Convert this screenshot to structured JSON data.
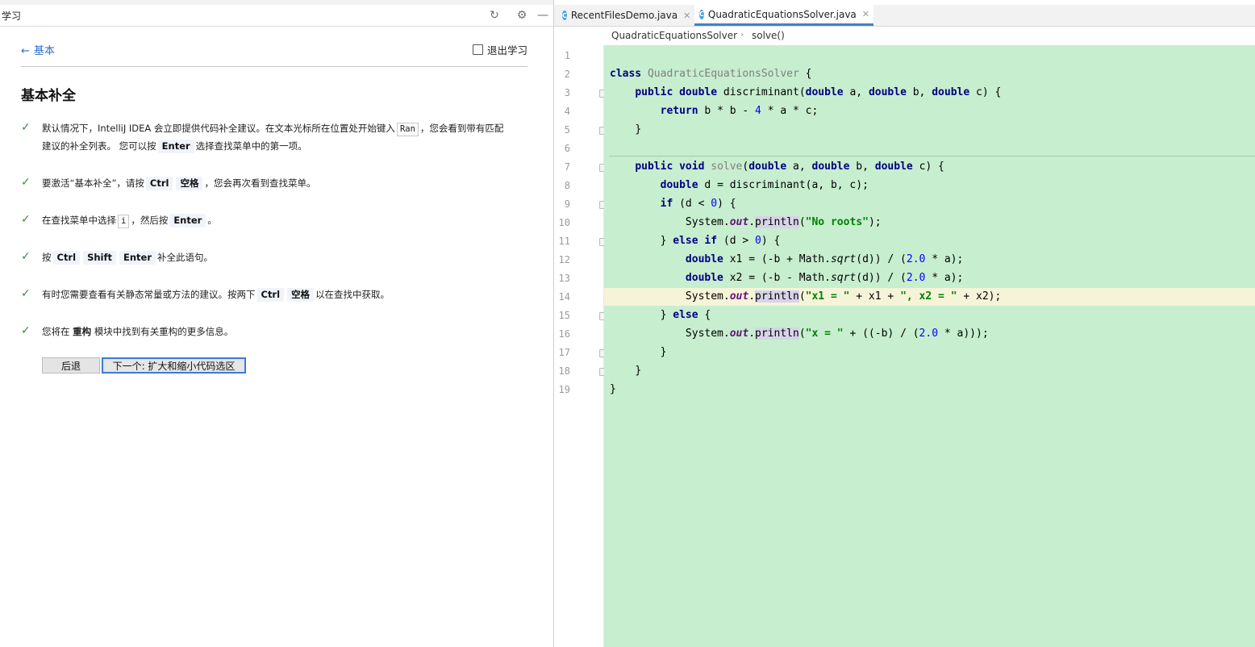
{
  "learn": {
    "panel_title": "学习",
    "back_label": "基本",
    "exit_label": "退出学习",
    "lesson_title": "基本补全",
    "steps": [
      {
        "t1": "默认情况下，IntelliJ IDEA 会立即提供代码补全建议。在文本光标所在位置处开始键入",
        "code": "Ran",
        "t2": "，您会看到带有匹配",
        "t3": "建议的补全列表。 您可以按",
        "key": "Enter",
        "t4": "选择查找菜单中的第一项。"
      },
      {
        "t1": "要激活“基本补全”，请按",
        "key1": "Ctrl",
        "key2": "空格",
        "t2": "，您会再次看到查找菜单。"
      },
      {
        "t1": "在查找菜单中选择",
        "code": "i",
        "t2": "，然后按",
        "key": "Enter",
        "t3": "。"
      },
      {
        "t1": "按",
        "key1": "Ctrl",
        "key2": "Shift",
        "key3": "Enter",
        "t2": "补全此语句。"
      },
      {
        "t1": "有时您需要查看有关静态常量或方法的建议。按两下",
        "key1": "Ctrl",
        "key2": "空格",
        "t2": "以在查找中获取。"
      },
      {
        "t1": "您将在",
        "bold": "重构",
        "t2": "模块中找到有关重构的更多信息。"
      }
    ],
    "btn_back": "后退",
    "btn_next": "下一个: 扩大和缩小代码选区"
  },
  "editor": {
    "tabs": [
      "RecentFilesDemo.java",
      "QuadraticEquationsSolver.java"
    ],
    "breadcrumb": [
      "QuadraticEquationsSolver",
      "solve()"
    ],
    "line_numbers": [
      "1",
      "2",
      "3",
      "4",
      "5",
      "6",
      "7",
      "8",
      "9",
      "10",
      "11",
      "12",
      "13",
      "14",
      "15",
      "16",
      "17",
      "18",
      "19"
    ],
    "code": {
      "l2_kw": "class",
      "l2_name": "QuadraticEquationsSolver",
      "l2_rest": " {",
      "l3": {
        "a": "public",
        "b": "double",
        "c": " discriminant(",
        "d": "double",
        "e": " a, ",
        "f": "double",
        "g": " b, ",
        "h": "double",
        "i": " c) {"
      },
      "l4": {
        "kw": "return",
        "a": " b * b - ",
        "num": "4",
        "b": " * a * c;"
      },
      "l5": "}",
      "l7": {
        "a": "public",
        "b": "void",
        "name": "solve",
        "c": "(",
        "d": "double",
        "e": " a, ",
        "f": "double",
        "g": " b, ",
        "h": "double",
        "i": " c) {"
      },
      "l8": {
        "kw": "double",
        "rest": " d = discriminant(a, b, c);"
      },
      "l9": {
        "kw": "if",
        "a": " (d < ",
        "num": "0",
        "b": ") {"
      },
      "l10": {
        "a": "System.",
        "fld": "out",
        "b": ".",
        "m": "println",
        "c": "(",
        "str": "\"No roots\"",
        "d": ");"
      },
      "l11": {
        "a": "} ",
        "kw1": "else",
        "sp": " ",
        "kw2": "if",
        "b": " (d > ",
        "num": "0",
        "c": ") {"
      },
      "l12": {
        "kw": "double",
        "a": " x1 = (-b + Math.",
        "m": "sqrt",
        "b": "(d)) / (",
        "num": "2.0",
        "c": " * a);"
      },
      "l13": {
        "kw": "double",
        "a": " x2 = (-b - Math.",
        "m": "sqrt",
        "b": "(d)) / (",
        "num": "2.0",
        "c": " * a);"
      },
      "l14": {
        "a": "System.",
        "fld": "out",
        "b": ".",
        "m": "println",
        "c": "(",
        "s1": "\"x1 = \"",
        "d": " + x1 + ",
        "s2": "\", x2 = \"",
        "e": " + x2);"
      },
      "l15": {
        "a": "} ",
        "kw": "else",
        "b": " {"
      },
      "l16": {
        "a": "System.",
        "fld": "out",
        "b": ".",
        "m": "println",
        "c": "(",
        "str": "\"x = \"",
        "d": " + ((-b) / (",
        "num": "2.0",
        "e": " * a)));"
      },
      "l17": "}",
      "l18": "}",
      "l19": "}"
    }
  }
}
